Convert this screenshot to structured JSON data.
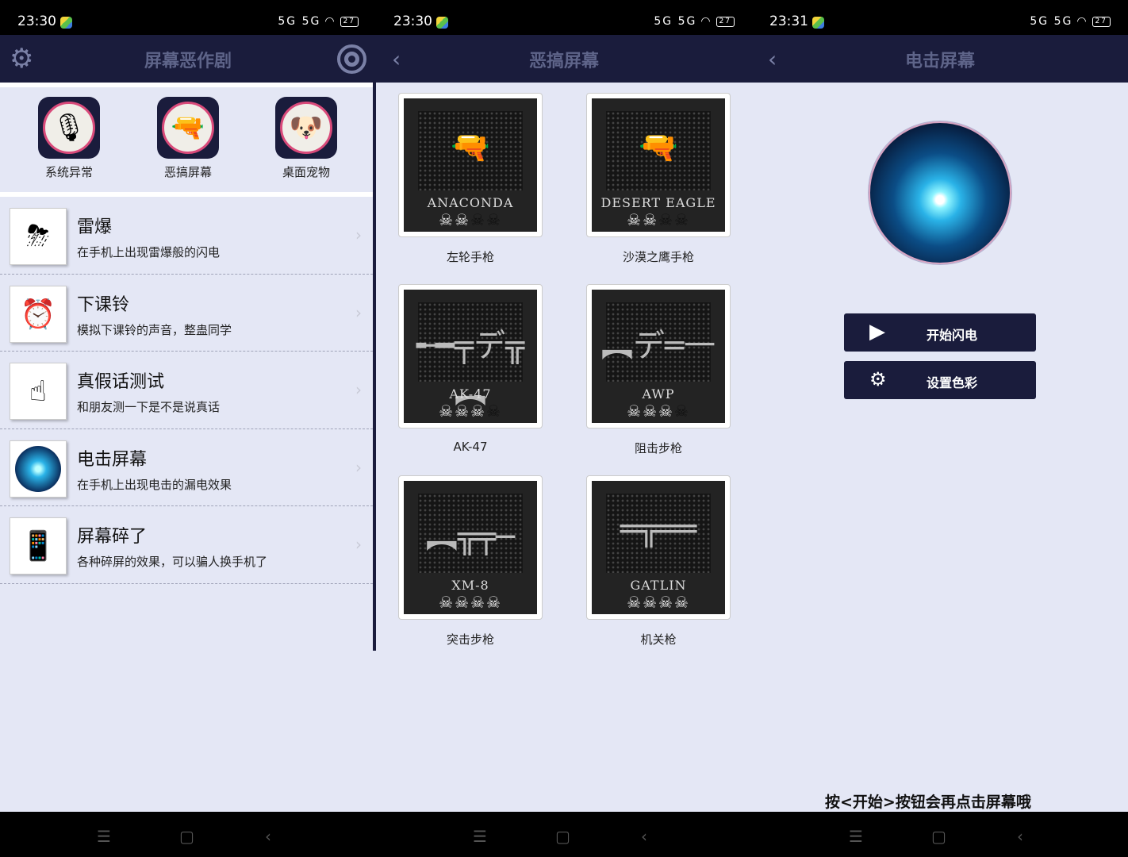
{
  "status": [
    {
      "time": "23:30",
      "icons": "5G 5G",
      "battery": "27"
    },
    {
      "time": "23:30",
      "icons": "5G 5G",
      "battery": "27"
    },
    {
      "time": "23:31",
      "icons": "5G 5G",
      "battery": "27"
    }
  ],
  "panel1": {
    "title": "屏幕恶作剧",
    "categories": [
      {
        "label": "系统异常",
        "icon": "microphone-icon"
      },
      {
        "label": "恶搞屏幕",
        "icon": "pistol-icon"
      },
      {
        "label": "桌面宠物",
        "icon": "dog-icon"
      }
    ],
    "items": [
      {
        "title": "雷爆",
        "subtitle": "在手机上出现雷爆般的闪电",
        "icon": "storm-icon"
      },
      {
        "title": "下课铃",
        "subtitle": "模拟下课铃的声音，整蛊同学",
        "icon": "alarm-clock-icon"
      },
      {
        "title": "真假话测试",
        "subtitle": "和朋友测一下是不是说真话",
        "icon": "fingerprint-icon"
      },
      {
        "title": "电击屏幕",
        "subtitle": "在手机上出现电击的漏电效果",
        "icon": "plasma-icon"
      },
      {
        "title": "屏幕碎了",
        "subtitle": "各种碎屏的效果，可以骗人换手机了",
        "icon": "phone-icon"
      }
    ]
  },
  "panel2": {
    "title": "恶搞屏幕",
    "guns": [
      {
        "name": "ANACONDA",
        "caption": "左轮手枪",
        "rating": 2
      },
      {
        "name": "DESERT EAGLE",
        "caption": "沙漠之鹰手枪",
        "rating": 2
      },
      {
        "name": "AK-47",
        "caption": "AK-47",
        "rating": 3
      },
      {
        "name": "AWP",
        "caption": "阻击步枪",
        "rating": 3
      },
      {
        "name": "XM-8",
        "caption": "突击步枪",
        "rating": 4
      },
      {
        "name": "GATLIN",
        "caption": "机关枪",
        "rating": 4
      }
    ]
  },
  "panel3": {
    "title": "电击屏幕",
    "start_label": "开始闪电",
    "color_label": "设置色彩",
    "hint": "按<开始>按钮会再点击屏幕哦"
  },
  "colors": {
    "nav": "#1a1c3c",
    "background": "#e4e7f5",
    "title_text": "#5e6489"
  }
}
